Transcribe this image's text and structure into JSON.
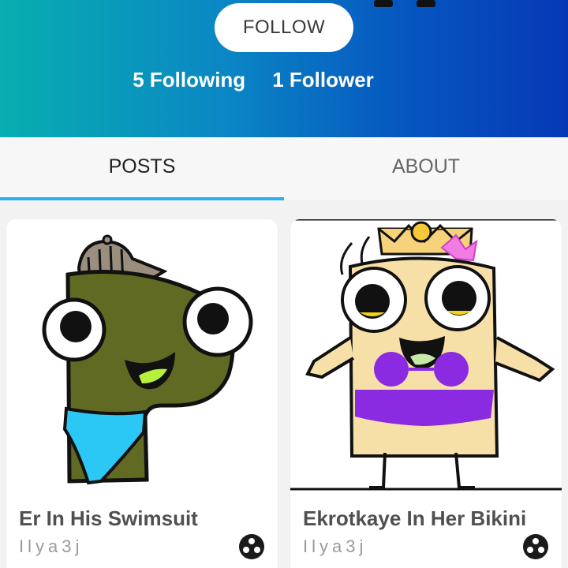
{
  "profile": {
    "follow_label": "FOLLOW",
    "following_text": "5 Following",
    "followers_text": "1 Follower"
  },
  "tabs": [
    {
      "label": "POSTS",
      "active": true
    },
    {
      "label": "ABOUT",
      "active": false
    }
  ],
  "posts": [
    {
      "title": "Er In His Swimsuit",
      "author": "Ilya3j",
      "icon": "community-icon"
    },
    {
      "title": "Ekrotkaye In Her Bikini",
      "author": "Ilya3j",
      "icon": "community-icon"
    }
  ],
  "colors": {
    "header_gradient_start": "#08aeb0",
    "header_gradient_end": "#0638b6",
    "tab_indicator": "#2ab0ec"
  }
}
